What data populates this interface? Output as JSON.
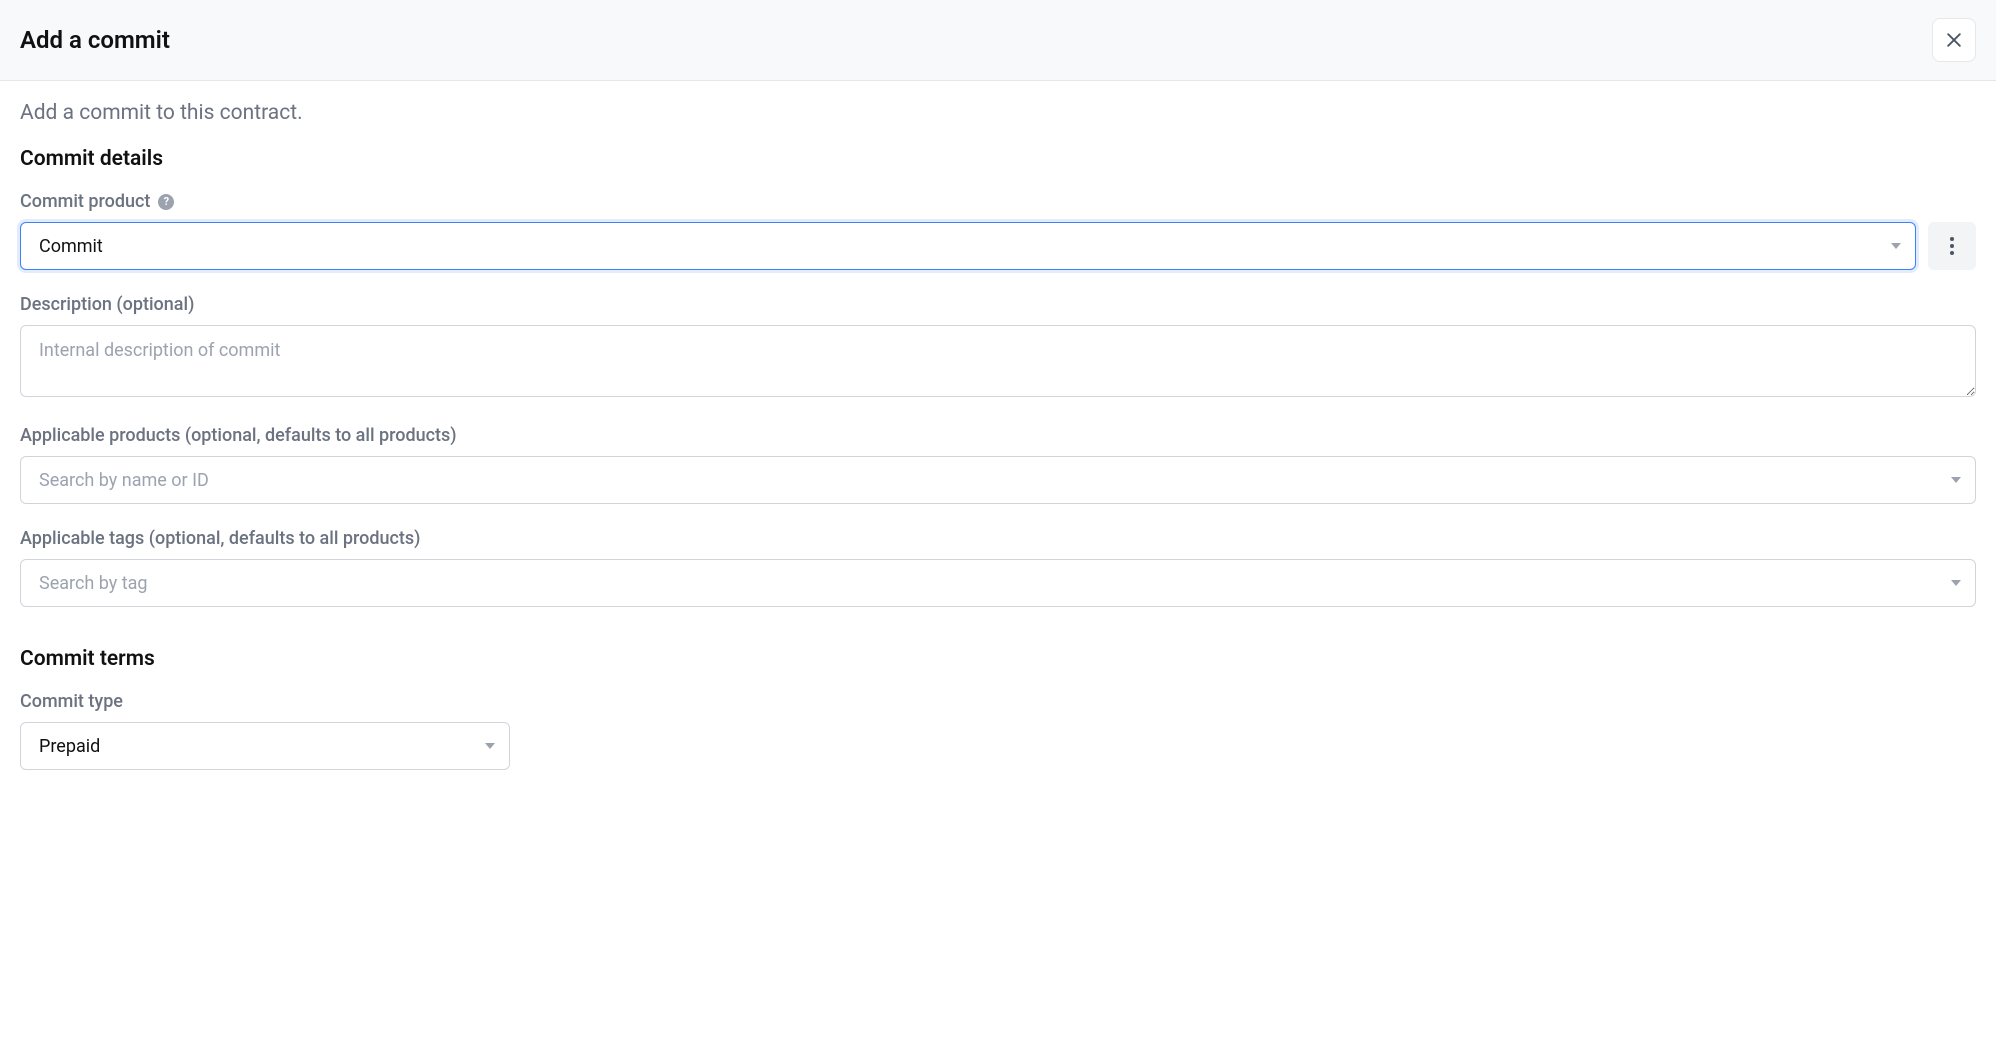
{
  "header": {
    "title": "Add a commit"
  },
  "subtitle": "Add a commit to this contract.",
  "sections": {
    "details": {
      "title": "Commit details",
      "commitProduct": {
        "label": "Commit product",
        "value": "Commit"
      },
      "description": {
        "label": "Description (optional)",
        "placeholder": "Internal description of commit"
      },
      "applicableProducts": {
        "label": "Applicable products (optional, defaults to all products)",
        "placeholder": "Search by name or ID"
      },
      "applicableTags": {
        "label": "Applicable tags (optional, defaults to all products)",
        "placeholder": "Search by tag"
      }
    },
    "terms": {
      "title": "Commit terms",
      "commitType": {
        "label": "Commit type",
        "value": "Prepaid"
      }
    }
  }
}
